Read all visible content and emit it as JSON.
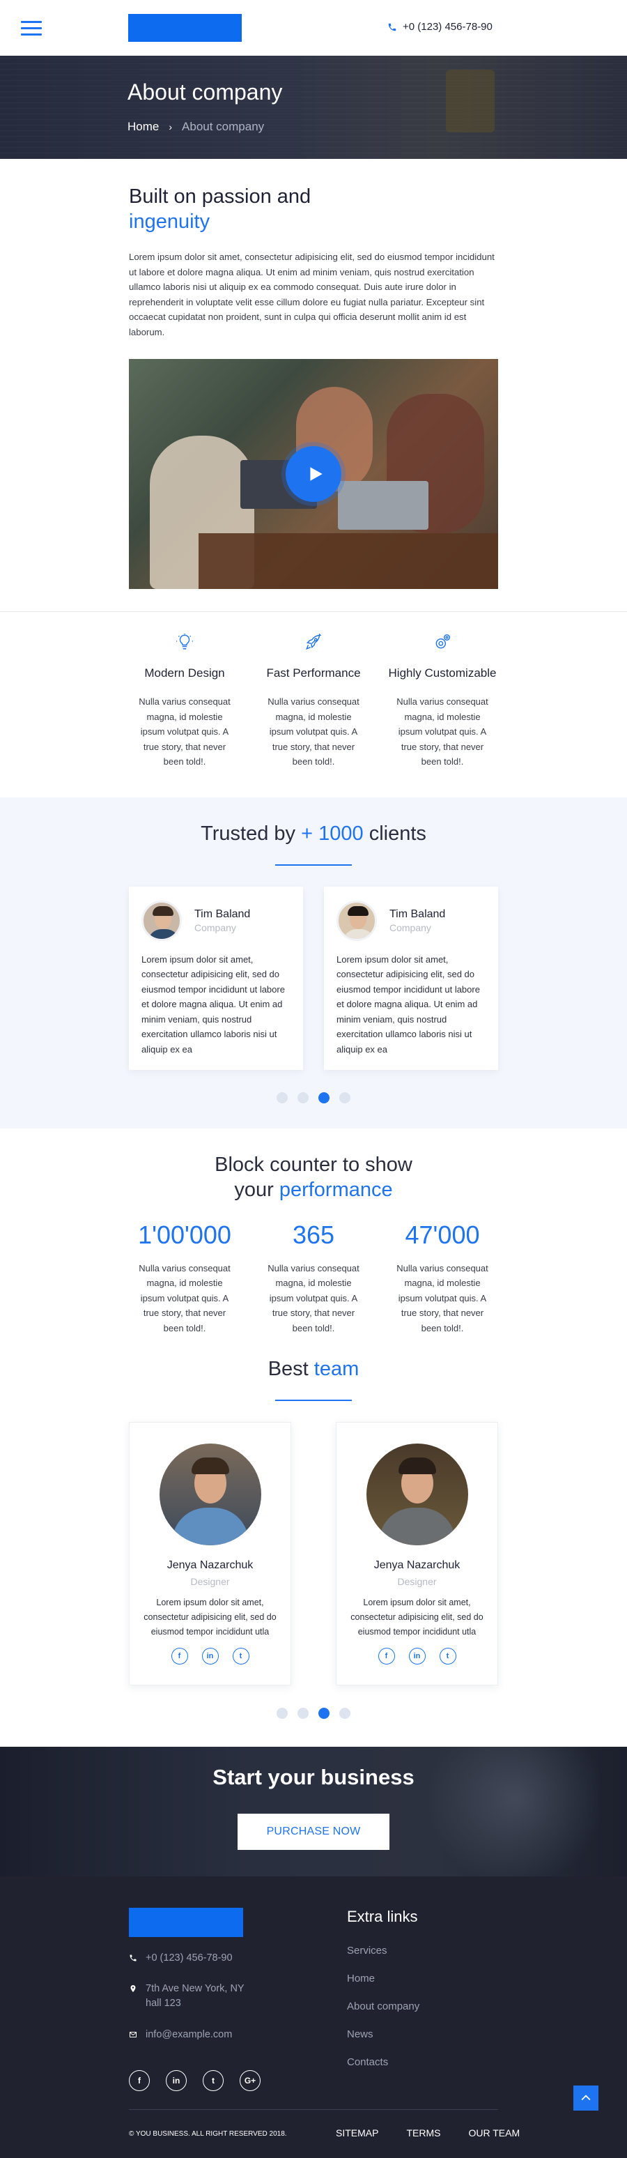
{
  "header": {
    "phone": "+0 (123) 456-78-90"
  },
  "hero": {
    "title": "About company",
    "breadcrumb_home": "Home",
    "breadcrumb_current": "About company"
  },
  "intro": {
    "title_line1": "Built on passion and",
    "title_line2": "ingenuity",
    "text": "Lorem ipsum dolor sit amet, consectetur adipisicing elit, sed do eiusmod tempor incididunt ut labore et dolore magna aliqua. Ut enim ad minim veniam, quis nostrud exercitation ullamco laboris nisi ut aliquip ex ea commodo consequat. Duis aute irure dolor in reprehenderit in voluptate velit esse cillum dolore eu fugiat nulla pariatur. Excepteur sint occaecat cupidatat non proident, sunt in culpa qui officia deserunt mollit anim id est laborum."
  },
  "features": [
    {
      "icon": "lightbulb-icon",
      "title": "Modern Design",
      "text": "Nulla varius consequat magna, id molestie ipsum volutpat quis. A true story, that never been told!."
    },
    {
      "icon": "rocket-icon",
      "title": "Fast Performance",
      "text": "Nulla varius consequat magna, id molestie ipsum volutpat quis. A true story, that never been told!."
    },
    {
      "icon": "gears-icon",
      "title": "Highly Customizable",
      "text": "Nulla varius consequat magna, id molestie ipsum volutpat quis. A true story, that never been told!."
    }
  ],
  "trusted": {
    "title_before": "Trusted by",
    "title_highlight": "+ 1000",
    "title_after": "clients",
    "testimonials": [
      {
        "name": "Tim Baland",
        "company": "Company",
        "text": "Lorem ipsum dolor sit amet, consectetur adipisicing elit, sed do eiusmod tempor incididunt ut labore et dolore magna aliqua. Ut enim ad minim veniam, quis nostrud exercitation ullamco laboris nisi ut aliquip ex ea"
      },
      {
        "name": "Tim Baland",
        "company": "Company",
        "text": "Lorem ipsum dolor sit amet, consectetur adipisicing elit, sed do eiusmod tempor incididunt ut labore et dolore magna aliqua. Ut enim ad minim veniam, quis nostrud exercitation ullamco laboris nisi ut aliquip ex ea"
      }
    ],
    "active_dot": 3
  },
  "counter": {
    "title_line1": "Block counter to show",
    "title_line2_before": "your",
    "title_line2_highlight": "performance",
    "items": [
      {
        "value": "1'00'000",
        "text": "Nulla varius consequat magna, id molestie ipsum volutpat quis. A true story, that never been told!."
      },
      {
        "value": "365",
        "text": "Nulla varius consequat magna, id molestie ipsum volutpat quis. A true story, that never been told!."
      },
      {
        "value": "47'000",
        "text": "Nulla varius consequat magna, id molestie ipsum volutpat quis. A true story, that never been told!."
      }
    ]
  },
  "team": {
    "title_before": "Best",
    "title_highlight": "team",
    "members": [
      {
        "name": "Jenya Nazarchuk",
        "role": "Designer",
        "text": "Lorem ipsum dolor sit amet, consectetur adipisicing elit, sed do eiusmod tempor incididunt utla"
      },
      {
        "name": "Jenya Nazarchuk",
        "role": "Designer",
        "text": "Lorem ipsum dolor sit amet, consectetur adipisicing elit, sed do eiusmod tempor incididunt utla"
      }
    ],
    "social_glyphs": [
      "f",
      "in",
      "t"
    ],
    "active_dot": 3
  },
  "cta": {
    "title": "Start your business",
    "button": "PURCHASE NOW"
  },
  "footer": {
    "phone": "+0 (123) 456-78-90",
    "address": "7th Ave New York, NY hall 123",
    "email": "info@example.com",
    "social_glyphs": [
      "f",
      "in",
      "t",
      "G+"
    ],
    "extra_title": "Extra links",
    "links": [
      "Services",
      "Home",
      "About company",
      "News",
      "Contacts"
    ],
    "copyright": "© YOU BUSINESS. ALL RIGHT RESERVED 2018.",
    "bottom_links": [
      "SITEMAP",
      "TERMS",
      "OUR TEAM"
    ]
  },
  "colors": {
    "accent": "#1e74f0",
    "dark": "#20232f",
    "light_bg": "#f3f6fd"
  }
}
